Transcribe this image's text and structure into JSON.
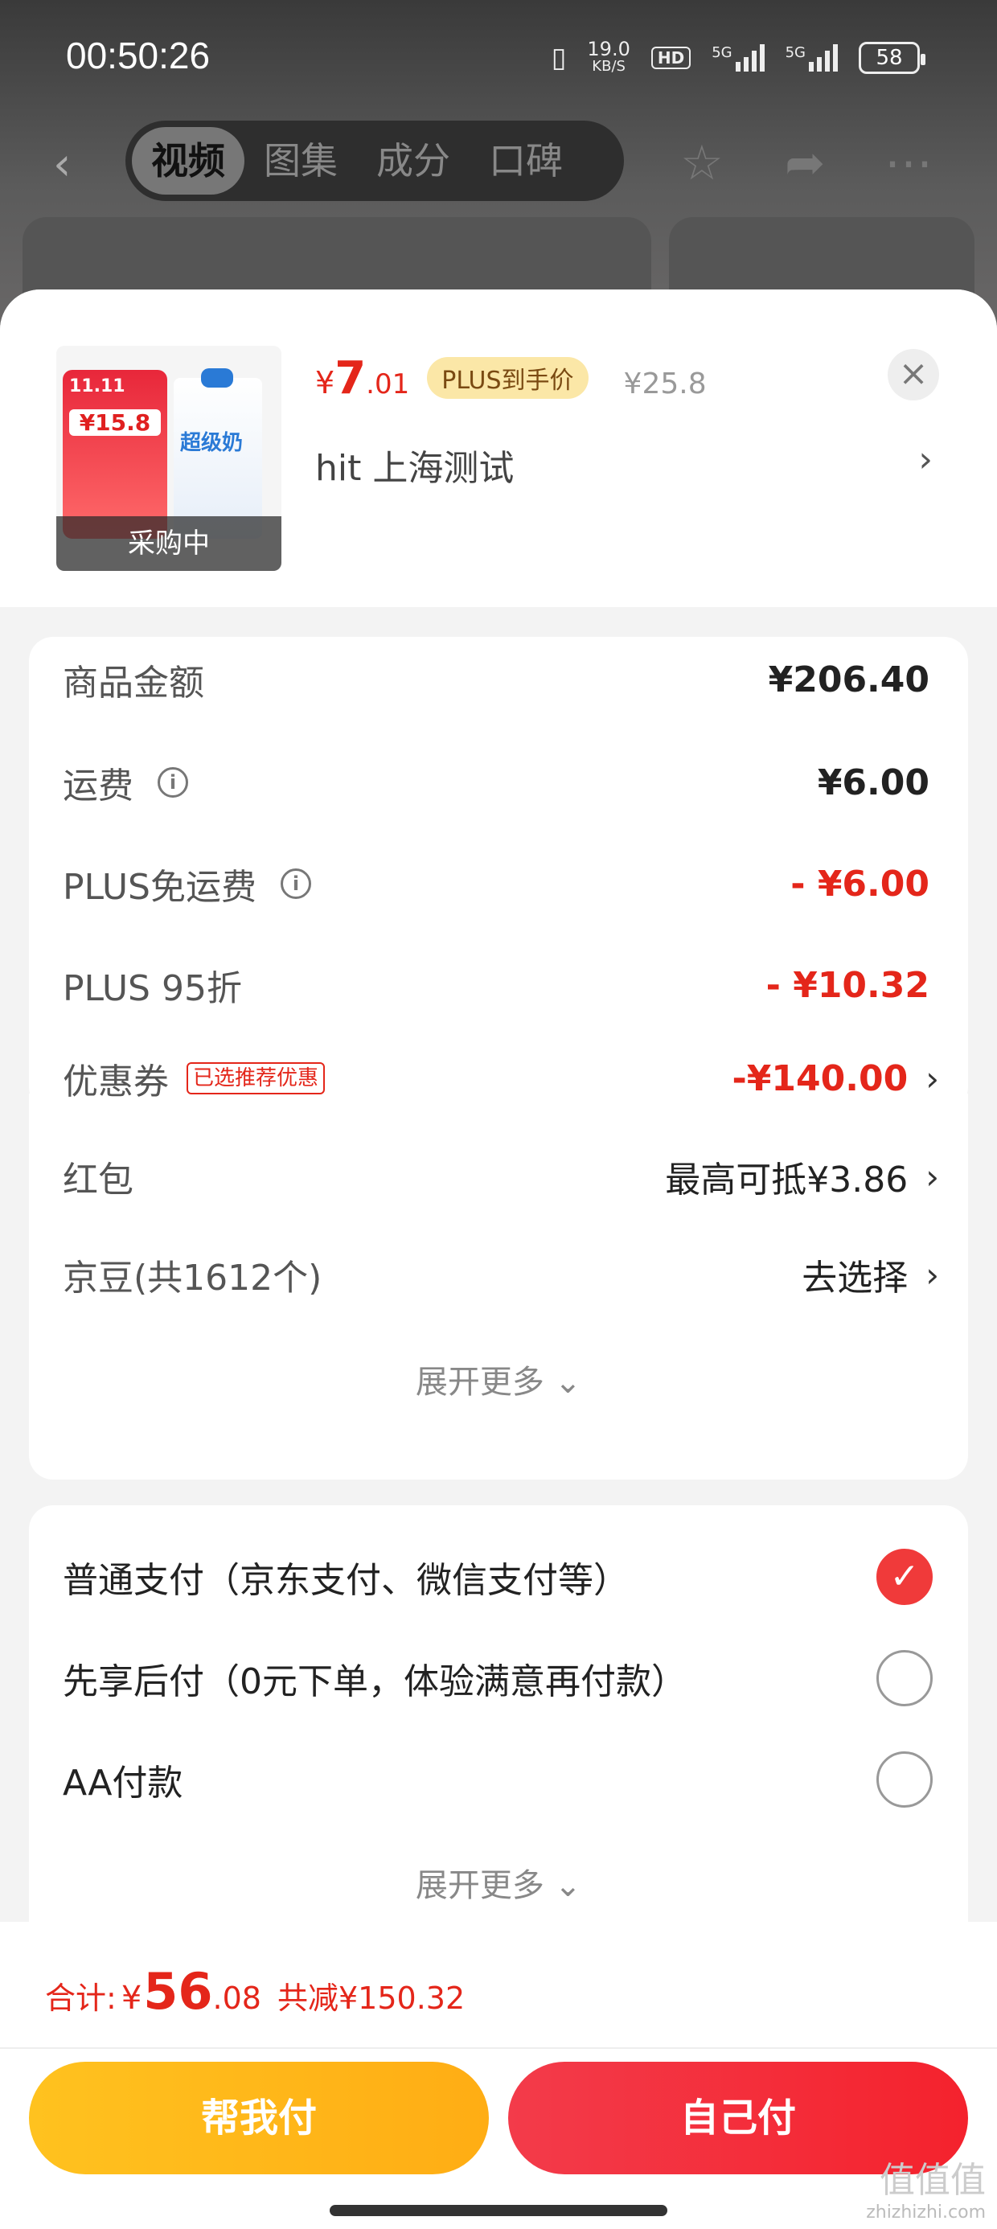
{
  "status_bar": {
    "time": "00:50:26",
    "net_speed": "19.0",
    "net_unit": "KB/S",
    "hd": "HD",
    "sig1": "5G",
    "sig2": "5G",
    "battery": "58"
  },
  "nav": {
    "tabs": [
      "视频",
      "图集",
      "成分",
      "口碑"
    ],
    "active_tab": 0
  },
  "product": {
    "thumb_overlay": "采购中",
    "thumb_promo_title": "11.11",
    "thumb_promo_price": "¥15.8",
    "thumb_brand": "超级奶",
    "currency": "¥",
    "price_int": "7",
    "price_dec": ".01",
    "plus_label": "PLUS到手价",
    "original_price": "¥25.8",
    "name": "hit  上海测试"
  },
  "costs": {
    "rows": [
      {
        "label": "商品金额",
        "value": "¥206.40"
      },
      {
        "label": "运费",
        "value": "¥6.00"
      },
      {
        "label": "PLUS免运费",
        "value": "- ¥6.00"
      },
      {
        "label": "PLUS 95折",
        "value": "- ¥10.32"
      },
      {
        "label": "优惠券",
        "tag": "已选推荐优惠",
        "value": "-¥140.00"
      },
      {
        "label": "红包",
        "value": "最高可抵¥3.86"
      },
      {
        "label": "京豆(共1612个)",
        "value": "去选择"
      }
    ],
    "more_label": "展开更多"
  },
  "payment": {
    "options": [
      {
        "label": "普通支付（京东支付、微信支付等）",
        "selected": true
      },
      {
        "label": "先享后付（0元下单，体验满意再付款）",
        "selected": false
      },
      {
        "label": "AA付款",
        "selected": false
      }
    ],
    "more_label": "展开更多"
  },
  "footer": {
    "total_label": "合计:",
    "currency": "¥",
    "total_int": "56",
    "total_dec": ".08",
    "saved": "共减¥150.32",
    "btn_friend": "帮我付",
    "btn_self": "自己付"
  },
  "watermark": {
    "main": "值值值",
    "sub": "zhizhizhi.com"
  },
  "colors": {
    "accent_red": "#e4261a",
    "btn_yellow": "#ffb81a",
    "btn_red": "#f32e3a"
  }
}
